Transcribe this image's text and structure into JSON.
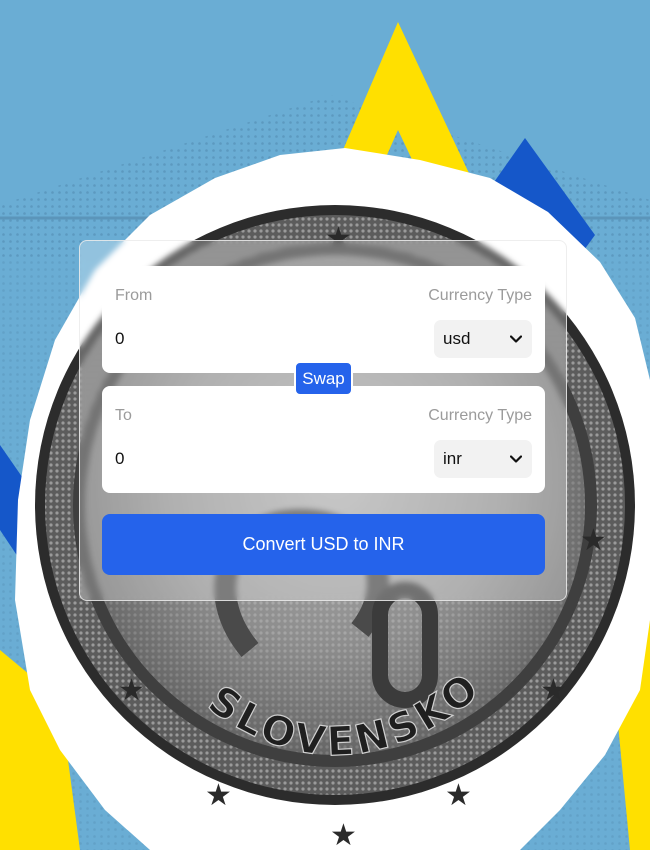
{
  "background": {
    "coin_text": "SLOVENSKO",
    "colors": {
      "sky": "#6aadd4",
      "yellow": "#ffe000",
      "blue": "#1557c9",
      "coin_dark": "#3a3a3a",
      "coin_light": "#cfcfcf"
    }
  },
  "converter": {
    "from": {
      "label": "From",
      "currency_label": "Currency Type",
      "amount": "0",
      "currency": "usd"
    },
    "swap_label": "Swap",
    "to": {
      "label": "To",
      "currency_label": "Currency Type",
      "amount": "0",
      "currency": "inr"
    },
    "convert_label": "Convert USD to INR",
    "accent_color": "#2563eb"
  }
}
